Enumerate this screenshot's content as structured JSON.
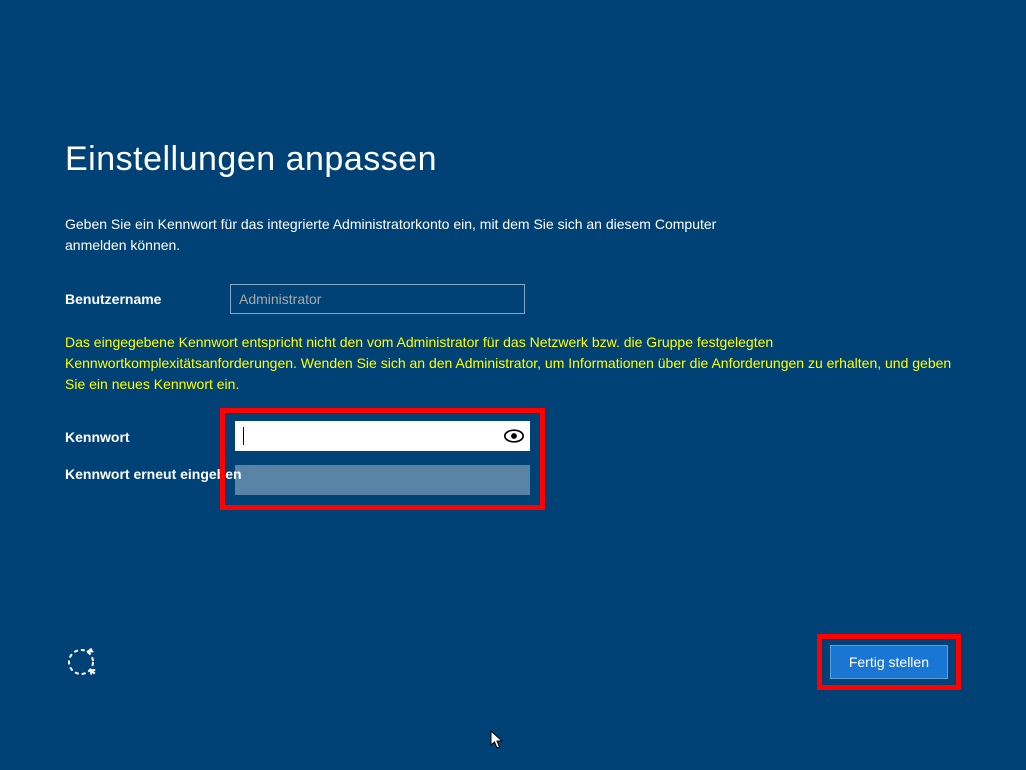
{
  "title": "Einstellungen anpassen",
  "description": "Geben Sie ein Kennwort für das integrierte Administratorkonto ein, mit dem Sie sich an diesem Computer anmelden können.",
  "username_label": "Benutzername",
  "username_value": "Administrator",
  "error_message": "Das eingegebene Kennwort entspricht nicht den vom Administrator für das Netzwerk bzw. die Gruppe festgelegten Kennwortkomplexitätsanforderungen. Wenden Sie sich an den Administrator, um Informationen über die Anforderungen zu erhalten, und geben Sie ein neues Kennwort ein.",
  "password_label": "Kennwort",
  "password_confirm_label": "Kennwort erneut eingeben",
  "finish_label": "Fertig stellen"
}
